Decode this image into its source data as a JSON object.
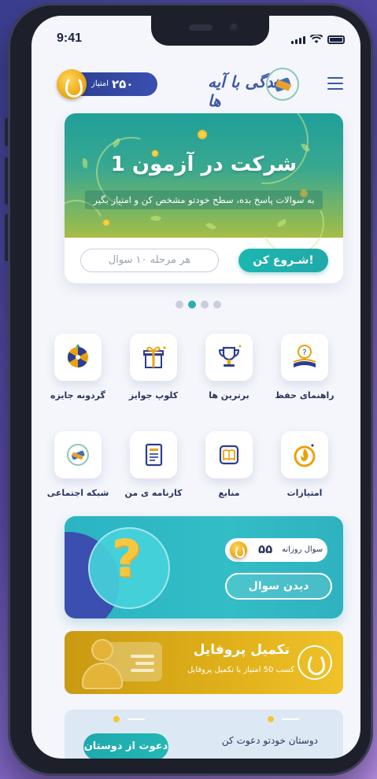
{
  "status": {
    "time": "9:41"
  },
  "header": {
    "score_value": "۲۵۰",
    "score_label": "امتیاز",
    "logo_text": "زندگی با آیه ها"
  },
  "hero": {
    "title": "شرکت در آزمون 1",
    "subtitle": "به سوالات پاسخ بده، سطح خودتو مشخص کن و امتیاز بگیر",
    "start_label": "شـروع کن!",
    "question_count": "هر مرحله ۱۰ سوال"
  },
  "carousel": {
    "dots": 4,
    "active": 1
  },
  "grid": {
    "items": [
      {
        "label": "راهنمای حفظ",
        "icon": "study-guide-icon"
      },
      {
        "label": "برترین ها",
        "icon": "trophy-icon"
      },
      {
        "label": "کلوپ جوایز",
        "icon": "gift-icon"
      },
      {
        "label": "گردونه جایزه",
        "icon": "prize-wheel-icon"
      },
      {
        "label": "امتیازات",
        "icon": "points-flame-icon"
      },
      {
        "label": "منابع",
        "icon": "book-icon"
      },
      {
        "label": "کارنامه ی من",
        "icon": "report-card-icon"
      },
      {
        "label": "شبکه اجتماعی",
        "icon": "social-network-icon"
      }
    ]
  },
  "daily": {
    "label": "سوال روزانه",
    "count": "۵۵",
    "button": "دیدن سوال"
  },
  "profile": {
    "title": "تکمیل پروفایل",
    "subtitle": "کسب 50 امتیاز با تکمیل پروفایل"
  },
  "invite": {
    "text": "دوستان خودتو دعوت کن",
    "button": "دعوت از دوستان"
  },
  "colors": {
    "accent": "#2aaeb3",
    "navy": "#2c3e90",
    "gold": "#e1b11a"
  }
}
